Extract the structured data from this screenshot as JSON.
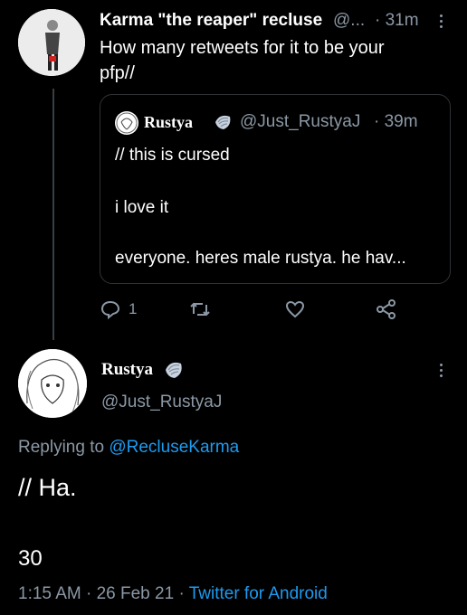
{
  "parent_tweet": {
    "display_name": "Karma \"the reaper\" recluse",
    "handle_truncated": "@...",
    "time": "· 31m",
    "text_line1": "How many retweets for it to be your",
    "text_line2": "pfp//"
  },
  "quoted_tweet": {
    "display_name": "Rustya",
    "handle": "@Just_RustyaJ",
    "time": "· 39m",
    "line1": "// this is cursed",
    "line2": "i love it",
    "line3": "everyone. heres male rustya. he hav..."
  },
  "actions": {
    "reply_count": "1"
  },
  "main_tweet": {
    "display_name": "Rustya",
    "handle": "@Just_RustyaJ",
    "replying_prefix": "Replying to",
    "replying_handle": "@RecluseKarma",
    "text": "// Ha.",
    "count": "30",
    "timestamp": "1:15 AM · 26 Feb 21 ·",
    "source": "Twitter for Android"
  },
  "icons": [
    "reply-icon",
    "retweet-icon",
    "like-icon",
    "share-icon",
    "verified-shell-icon",
    "more-icon"
  ]
}
